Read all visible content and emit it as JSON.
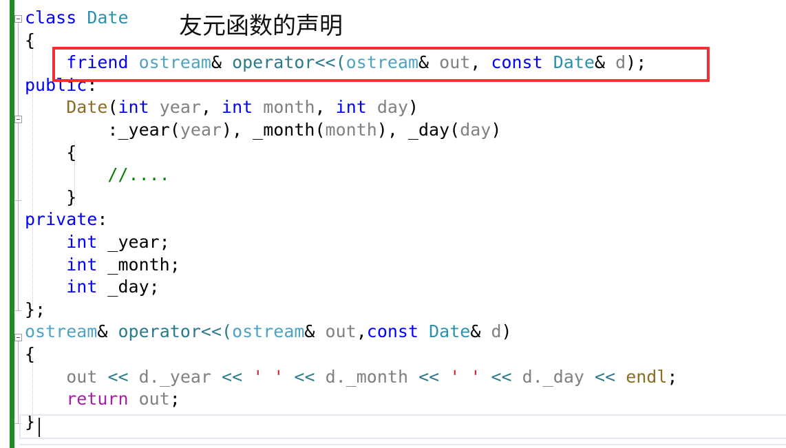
{
  "editor": {
    "language": "C++",
    "font_size_px": 25,
    "background": "#ffffff",
    "change_bar_color": "#1f8b23",
    "current_line_border": "#e6e6f0"
  },
  "annotation": {
    "text": "友元函数的声明",
    "translation_hint": "declaration of the friend function",
    "box_color": "#f23030"
  },
  "code": {
    "lines": [
      {
        "n": 1,
        "fold_marker": "collapse-minus",
        "tokens": [
          {
            "t": "class",
            "c": "kw"
          },
          {
            "t": " ",
            "c": "punct"
          },
          {
            "t": "Date",
            "c": "type"
          }
        ]
      },
      {
        "n": 2,
        "tokens": [
          {
            "t": "{",
            "c": "punct"
          }
        ]
      },
      {
        "n": 3,
        "highlighted": true,
        "tokens": [
          {
            "t": "    ",
            "c": "punct"
          },
          {
            "t": "friend",
            "c": "kw"
          },
          {
            "t": " ",
            "c": "punct"
          },
          {
            "t": "ostream",
            "c": "typelt"
          },
          {
            "t": "&",
            "c": "punct"
          },
          {
            "t": " ",
            "c": "punct"
          },
          {
            "t": "operator<<",
            "c": "func"
          },
          {
            "t": "(",
            "c": "func"
          },
          {
            "t": "ostream",
            "c": "typelt"
          },
          {
            "t": "&",
            "c": "punct"
          },
          {
            "t": " ",
            "c": "punct"
          },
          {
            "t": "out",
            "c": "ident"
          },
          {
            "t": ", ",
            "c": "punct"
          },
          {
            "t": "const",
            "c": "kw"
          },
          {
            "t": " ",
            "c": "punct"
          },
          {
            "t": "Date",
            "c": "type"
          },
          {
            "t": "&",
            "c": "punct"
          },
          {
            "t": " ",
            "c": "punct"
          },
          {
            "t": "d",
            "c": "ident"
          },
          {
            "t": ");",
            "c": "punct"
          }
        ]
      },
      {
        "n": 4,
        "tokens": [
          {
            "t": "public",
            "c": "kw"
          },
          {
            "t": ":",
            "c": "punct"
          }
        ]
      },
      {
        "n": 5,
        "fold_marker": "collapse-minus",
        "tokens": [
          {
            "t": "    ",
            "c": "punct"
          },
          {
            "t": "Date",
            "c": "ctor"
          },
          {
            "t": "(",
            "c": "punct"
          },
          {
            "t": "int",
            "c": "kw"
          },
          {
            "t": " ",
            "c": "punct"
          },
          {
            "t": "year",
            "c": "ident"
          },
          {
            "t": ", ",
            "c": "punct"
          },
          {
            "t": "int",
            "c": "kw"
          },
          {
            "t": " ",
            "c": "punct"
          },
          {
            "t": "month",
            "c": "ident"
          },
          {
            "t": ", ",
            "c": "punct"
          },
          {
            "t": "int",
            "c": "kw"
          },
          {
            "t": " ",
            "c": "punct"
          },
          {
            "t": "day",
            "c": "ident"
          },
          {
            "t": ")",
            "c": "punct"
          }
        ]
      },
      {
        "n": 6,
        "tokens": [
          {
            "t": "        :_year(",
            "c": "punct"
          },
          {
            "t": "year",
            "c": "ident"
          },
          {
            "t": "), _month(",
            "c": "punct"
          },
          {
            "t": "month",
            "c": "ident"
          },
          {
            "t": "), _day(",
            "c": "punct"
          },
          {
            "t": "day",
            "c": "ident"
          },
          {
            "t": ")",
            "c": "punct"
          }
        ]
      },
      {
        "n": 7,
        "tokens": [
          {
            "t": "    {",
            "c": "punct"
          }
        ]
      },
      {
        "n": 8,
        "tokens": [
          {
            "t": "        ",
            "c": "punct"
          },
          {
            "t": "//....",
            "c": "comment"
          }
        ]
      },
      {
        "n": 9,
        "tokens": [
          {
            "t": "    }",
            "c": "punct"
          }
        ]
      },
      {
        "n": 10,
        "tokens": [
          {
            "t": "private",
            "c": "kw"
          },
          {
            "t": ":",
            "c": "punct"
          }
        ]
      },
      {
        "n": 11,
        "tokens": [
          {
            "t": "    ",
            "c": "punct"
          },
          {
            "t": "int",
            "c": "kw"
          },
          {
            "t": " _year;",
            "c": "punct"
          }
        ]
      },
      {
        "n": 12,
        "tokens": [
          {
            "t": "    ",
            "c": "punct"
          },
          {
            "t": "int",
            "c": "kw"
          },
          {
            "t": " _month;",
            "c": "punct"
          }
        ]
      },
      {
        "n": 13,
        "tokens": [
          {
            "t": "    ",
            "c": "punct"
          },
          {
            "t": "int",
            "c": "kw"
          },
          {
            "t": " _day;",
            "c": "punct"
          }
        ]
      },
      {
        "n": 14,
        "tokens": [
          {
            "t": "};",
            "c": "punct"
          }
        ]
      },
      {
        "n": 15,
        "fold_marker": "collapse-minus",
        "tokens": [
          {
            "t": "ostream",
            "c": "typelt"
          },
          {
            "t": "&",
            "c": "punct"
          },
          {
            "t": " ",
            "c": "punct"
          },
          {
            "t": "operator<<",
            "c": "func"
          },
          {
            "t": "(",
            "c": "func"
          },
          {
            "t": "ostream",
            "c": "typelt"
          },
          {
            "t": "&",
            "c": "punct"
          },
          {
            "t": " ",
            "c": "punct"
          },
          {
            "t": "out",
            "c": "ident"
          },
          {
            "t": ",",
            "c": "punct"
          },
          {
            "t": "const",
            "c": "kw"
          },
          {
            "t": " ",
            "c": "punct"
          },
          {
            "t": "Date",
            "c": "type"
          },
          {
            "t": "&",
            "c": "punct"
          },
          {
            "t": " ",
            "c": "punct"
          },
          {
            "t": "d",
            "c": "ident"
          },
          {
            "t": ")",
            "c": "punct"
          }
        ]
      },
      {
        "n": 16,
        "tokens": [
          {
            "t": "{",
            "c": "punct"
          }
        ]
      },
      {
        "n": 17,
        "tokens": [
          {
            "t": "    ",
            "c": "punct"
          },
          {
            "t": "out",
            "c": "ident"
          },
          {
            "t": " ",
            "c": "punct"
          },
          {
            "t": "<<",
            "c": "op"
          },
          {
            "t": " ",
            "c": "punct"
          },
          {
            "t": "d._year",
            "c": "ident"
          },
          {
            "t": " ",
            "c": "punct"
          },
          {
            "t": "<<",
            "c": "op"
          },
          {
            "t": " ",
            "c": "punct"
          },
          {
            "t": "' '",
            "c": "str"
          },
          {
            "t": " ",
            "c": "punct"
          },
          {
            "t": "<<",
            "c": "op"
          },
          {
            "t": " ",
            "c": "punct"
          },
          {
            "t": "d._month",
            "c": "ident"
          },
          {
            "t": " ",
            "c": "punct"
          },
          {
            "t": "<<",
            "c": "op"
          },
          {
            "t": " ",
            "c": "punct"
          },
          {
            "t": "' '",
            "c": "str"
          },
          {
            "t": " ",
            "c": "punct"
          },
          {
            "t": "<<",
            "c": "op"
          },
          {
            "t": " ",
            "c": "punct"
          },
          {
            "t": "d._day",
            "c": "ident"
          },
          {
            "t": " ",
            "c": "punct"
          },
          {
            "t": "<<",
            "c": "op"
          },
          {
            "t": " ",
            "c": "punct"
          },
          {
            "t": "endl",
            "c": "ctor"
          },
          {
            "t": ";",
            "c": "punct"
          }
        ]
      },
      {
        "n": 18,
        "tokens": [
          {
            "t": "    ",
            "c": "punct"
          },
          {
            "t": "return",
            "c": "ret"
          },
          {
            "t": " ",
            "c": "punct"
          },
          {
            "t": "out",
            "c": "ident"
          },
          {
            "t": ";",
            "c": "punct"
          }
        ]
      },
      {
        "n": 19,
        "current": true,
        "tokens": [
          {
            "t": "}",
            "c": "punct"
          }
        ]
      }
    ]
  }
}
